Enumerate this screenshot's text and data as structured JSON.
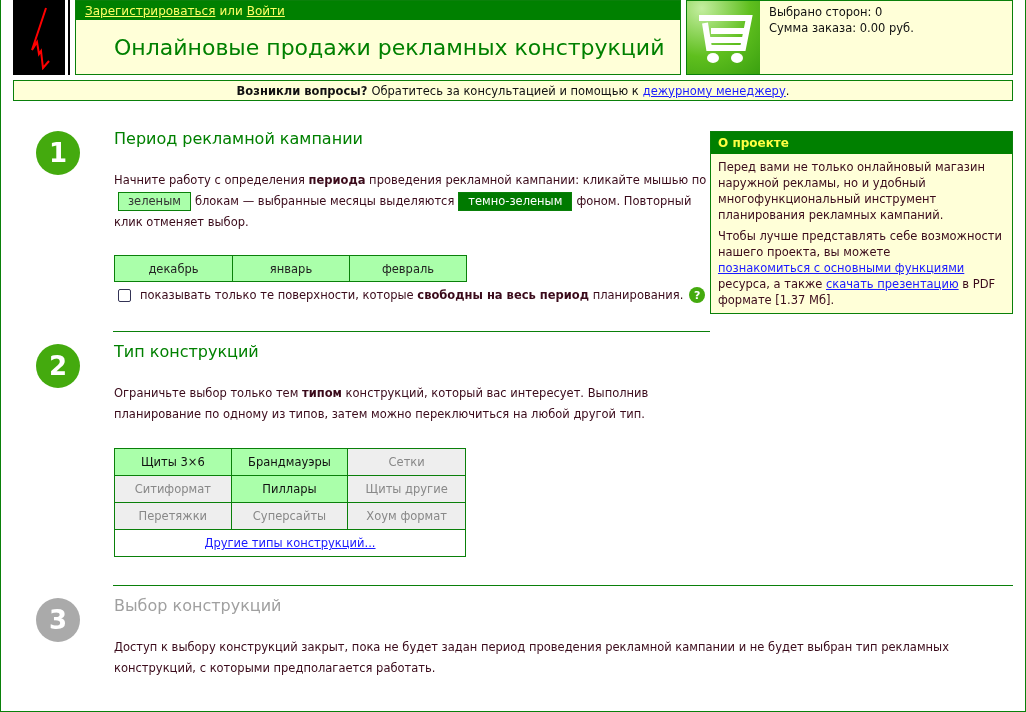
{
  "header": {
    "register_link": "Зарегистрироваться",
    "joiner": "или",
    "login_link": "Войти",
    "title": "Онлайновые продажи рекламных конструкций"
  },
  "cart": {
    "selected_sides": "Выбрано сторон: 0",
    "order_sum": "Сумма заказа: 0.00 руб."
  },
  "notice": {
    "lead": "Возникли вопросы?",
    "text": "Обратитесь за консультацией и помощью к",
    "link": "дежурному менеджеру",
    "tail": "."
  },
  "about": {
    "title": "О проекте",
    "paragraph_1": "Перед вами не только онлайновый магазин наружной рекламы, но и удобный многофункциональный инструмент планирования рекламных кампаний.",
    "paragraph_2": [
      {
        "kind": "text",
        "text": "Чтобы лучше представлять себе возможности нашего проекта, вы можете"
      },
      {
        "kind": "link",
        "text": "познакомиться с основными функциями"
      },
      {
        "kind": "text",
        "text": "ресурса, а также"
      },
      {
        "kind": "link",
        "text": "скачать презентацию"
      },
      {
        "kind": "text",
        "text": "в PDF формате [1.37 Мб]."
      }
    ]
  },
  "steps": [
    {
      "number": "1",
      "active": true,
      "title": "Период рекламной кампании",
      "kind": "period",
      "intro": [
        {
          "kind": "text",
          "text": "Начните работу с определения **периода** проведения рекламной кампании: кликайте мышью по"
        },
        {
          "kind": "chip",
          "selected": false,
          "text": "зеленым"
        },
        {
          "kind": "text",
          "text": "блокам — выбранные месяцы выделяются"
        },
        {
          "kind": "chip",
          "selected": true,
          "text": "темно-зеленым"
        },
        {
          "kind": "text",
          "text": "фоном. Повторный клик отменяет выбор."
        }
      ],
      "months": [
        {
          "label": "декабрь",
          "selected": false
        },
        {
          "label": "январь",
          "selected": false
        },
        {
          "label": "февраль",
          "selected": false
        }
      ],
      "free_only": {
        "label": "показывать только те поверхности, которые **свободны на весь период** планирования.",
        "checked": false,
        "help": "?"
      }
    },
    {
      "number": "2",
      "active": true,
      "title": "Тип конструкций",
      "kind": "types",
      "intro": [
        {
          "kind": "text",
          "text": "Ограничьте выбор только тем **типом** конструкций, который вас интересует. Выполнив планирование по одному из типов, затем можно переключиться на любой другой тип."
        }
      ],
      "types": [
        {
          "label": "Щиты 3×6",
          "disabled": false
        },
        {
          "label": "Брандмауэры",
          "disabled": false
        },
        {
          "label": "Сетки",
          "disabled": true
        },
        {
          "label": "Ситиформат",
          "disabled": true
        },
        {
          "label": "Пиллары",
          "disabled": false
        },
        {
          "label": "Щиты другие",
          "disabled": true
        },
        {
          "label": "Перетяжки",
          "disabled": true
        },
        {
          "label": "Суперсайты",
          "disabled": true
        },
        {
          "label": "Хоум формат",
          "disabled": true
        }
      ],
      "more_link": "Другие типы конструкций..."
    },
    {
      "number": "3",
      "active": false,
      "title": "Выбор конструкций",
      "kind": "choice",
      "intro": [
        {
          "kind": "text",
          "text": "Доступ к выбору конструкций закрыт, пока не будет задан период проведения рекламной кампании и не будет выбран тип рекламных конструкций, с которыми предполагается работать."
        }
      ]
    }
  ]
}
